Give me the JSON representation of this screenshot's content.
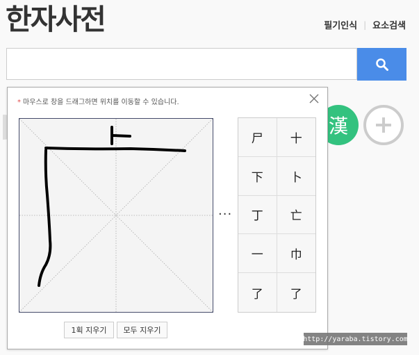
{
  "header": {
    "title": "한자사전",
    "links": [
      "필기인식",
      "요소검색"
    ],
    "separator": "|"
  },
  "search": {
    "value": "",
    "placeholder": "",
    "button_icon": "search-icon"
  },
  "side_buttons": {
    "hanja_label": "漢",
    "hanja_color": "#33c27f",
    "plus_icon": "plus-icon"
  },
  "popup": {
    "notice_star": "*",
    "notice": "마우스로 창을 드래그하면 위치를 이동할 수 있습니다.",
    "close_icon": "close-icon",
    "more_label": "···",
    "candidates": [
      "尸",
      "十",
      "下",
      "卜",
      "丁",
      "亡",
      "一",
      "巾",
      "了",
      "了"
    ],
    "clear_one_label": "1획 지우기",
    "clear_all_label": "모두 지우기"
  },
  "watermark": "http://yaraba.tistory.com"
}
